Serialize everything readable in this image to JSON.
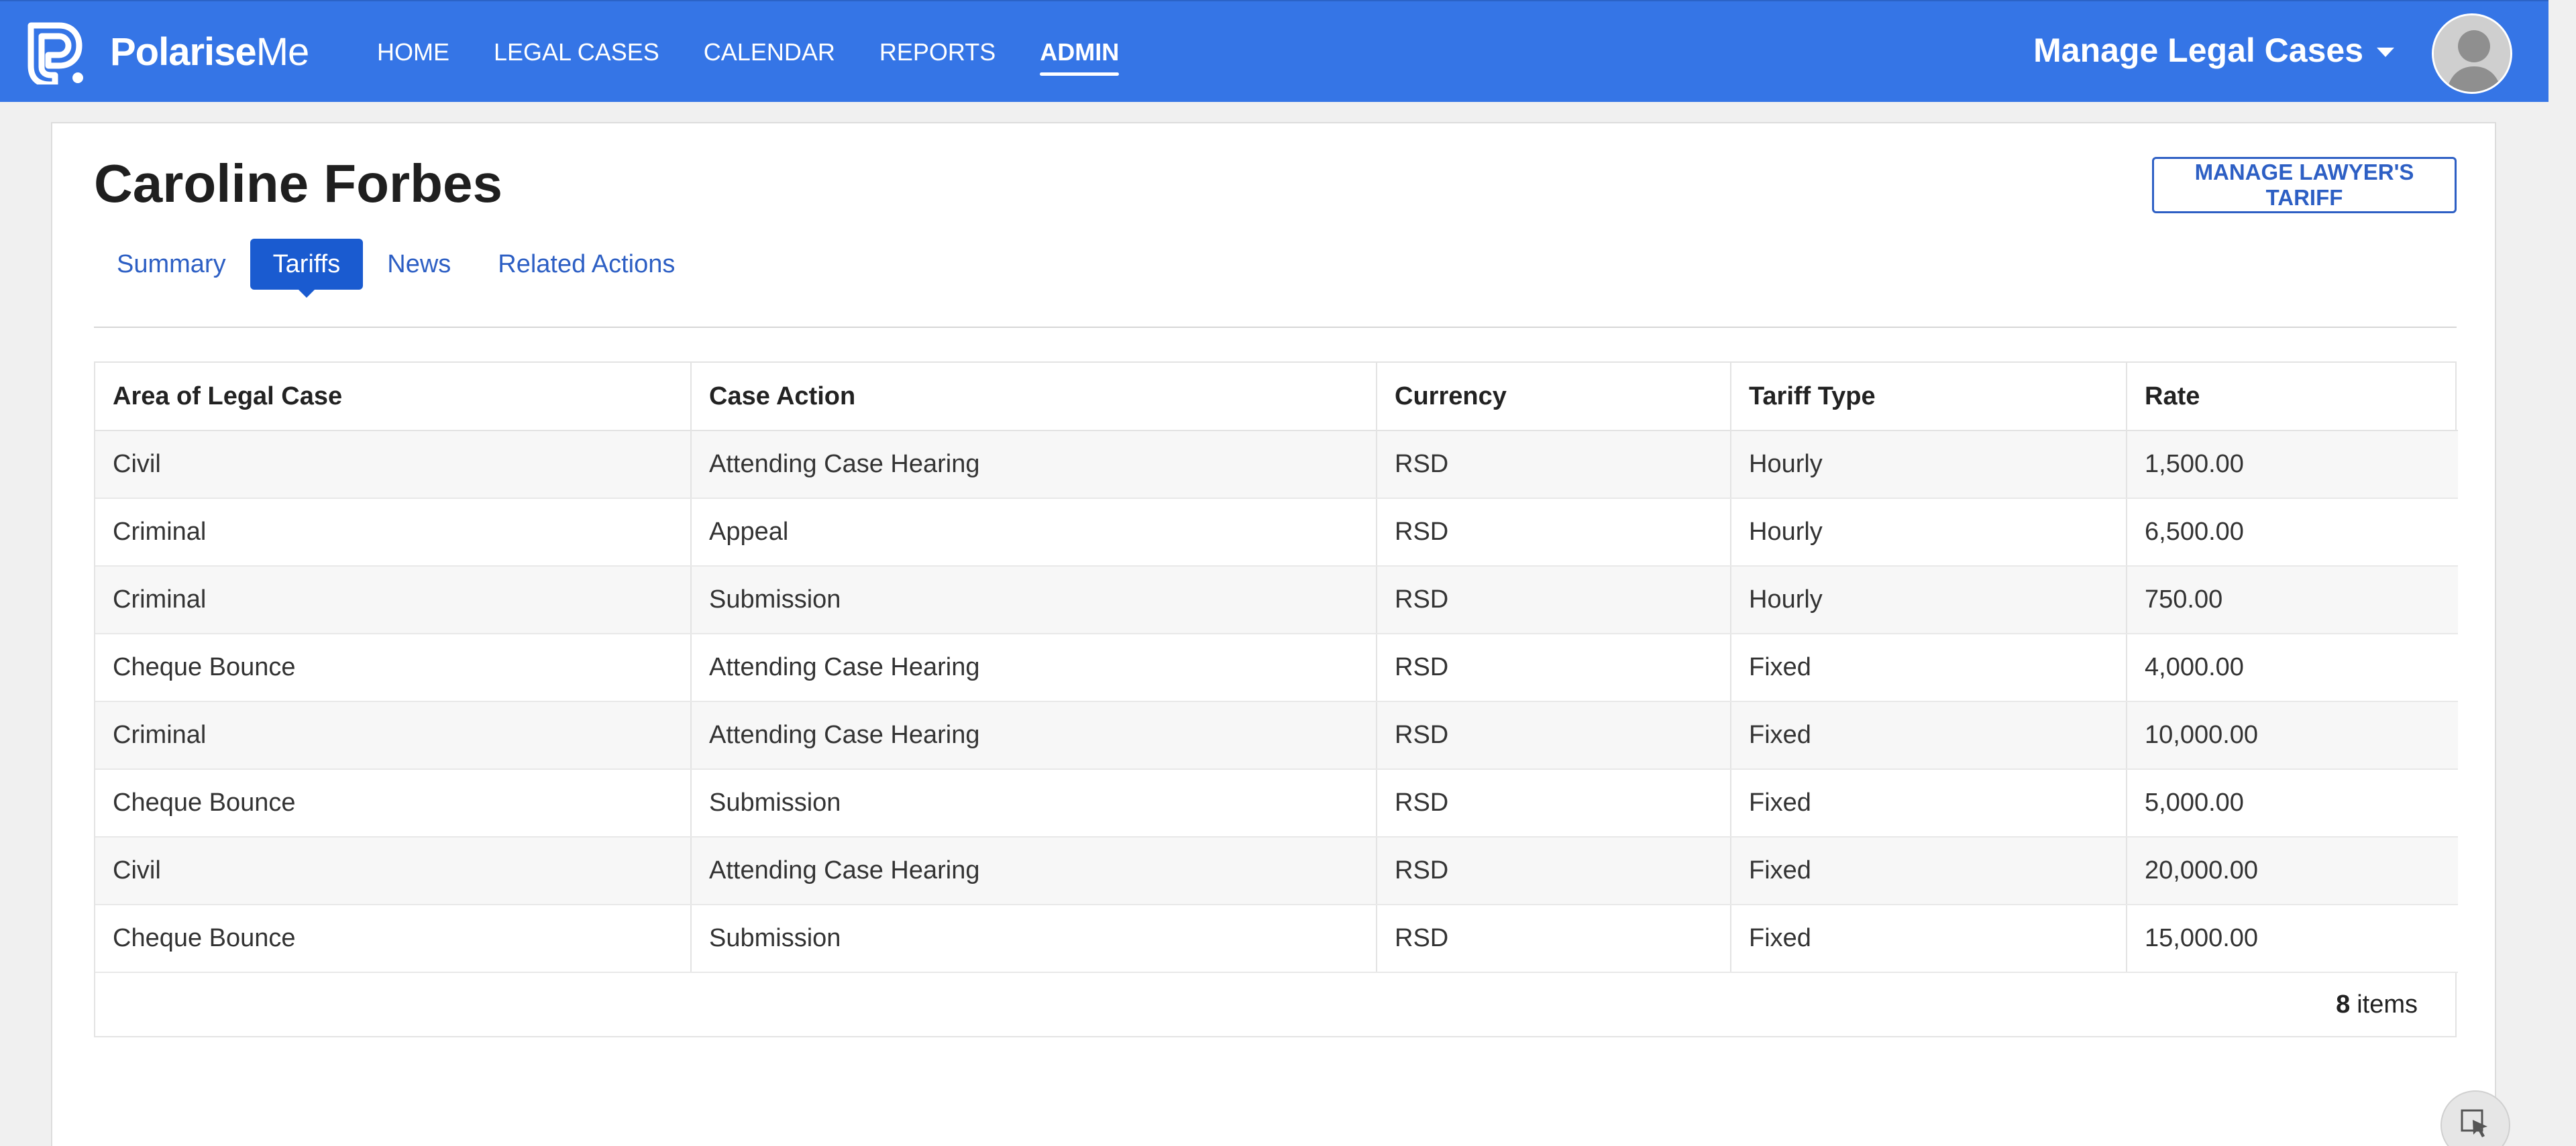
{
  "brand": {
    "name_bold": "Polarise",
    "name_light": "Me"
  },
  "nav": {
    "items": [
      {
        "label": "HOME"
      },
      {
        "label": "LEGAL CASES"
      },
      {
        "label": "CALENDAR"
      },
      {
        "label": "REPORTS"
      },
      {
        "label": "ADMIN"
      }
    ],
    "active": "ADMIN",
    "user_menu_label": "Manage Legal Cases"
  },
  "page": {
    "title": "Caroline Forbes",
    "manage_button": "MANAGE LAWYER'S TARIFF"
  },
  "tabs": [
    {
      "label": "Summary"
    },
    {
      "label": "Tariffs"
    },
    {
      "label": "News"
    },
    {
      "label": "Related Actions"
    }
  ],
  "active_tab": "Tariffs",
  "table": {
    "columns": [
      "Area of Legal Case",
      "Case Action",
      "Currency",
      "Tariff Type",
      "Rate"
    ],
    "rows": [
      [
        "Civil",
        "Attending Case Hearing",
        "RSD",
        "Hourly",
        "1,500.00"
      ],
      [
        "Criminal",
        "Appeal",
        "RSD",
        "Hourly",
        "6,500.00"
      ],
      [
        "Criminal",
        "Submission",
        "RSD",
        "Hourly",
        "750.00"
      ],
      [
        "Cheque Bounce",
        "Attending Case Hearing",
        "RSD",
        "Fixed",
        "4,000.00"
      ],
      [
        "Criminal",
        "Attending Case Hearing",
        "RSD",
        "Fixed",
        "10,000.00"
      ],
      [
        "Cheque Bounce",
        "Submission",
        "RSD",
        "Fixed",
        "5,000.00"
      ],
      [
        "Civil",
        "Attending Case Hearing",
        "RSD",
        "Fixed",
        "20,000.00"
      ],
      [
        "Cheque Bounce",
        "Submission",
        "RSD",
        "Fixed",
        "15,000.00"
      ]
    ]
  },
  "pager": {
    "count": "8",
    "label": "items"
  },
  "colors": {
    "nav_bg": "#3575e6",
    "link": "#2d5fc4",
    "active_tab_bg": "#1a5bd0"
  },
  "icons": {
    "logo": "polariseme-logo-icon",
    "avatar": "user-avatar-icon",
    "caret": "chevron-down-icon",
    "fab": "cursor-select-icon"
  }
}
